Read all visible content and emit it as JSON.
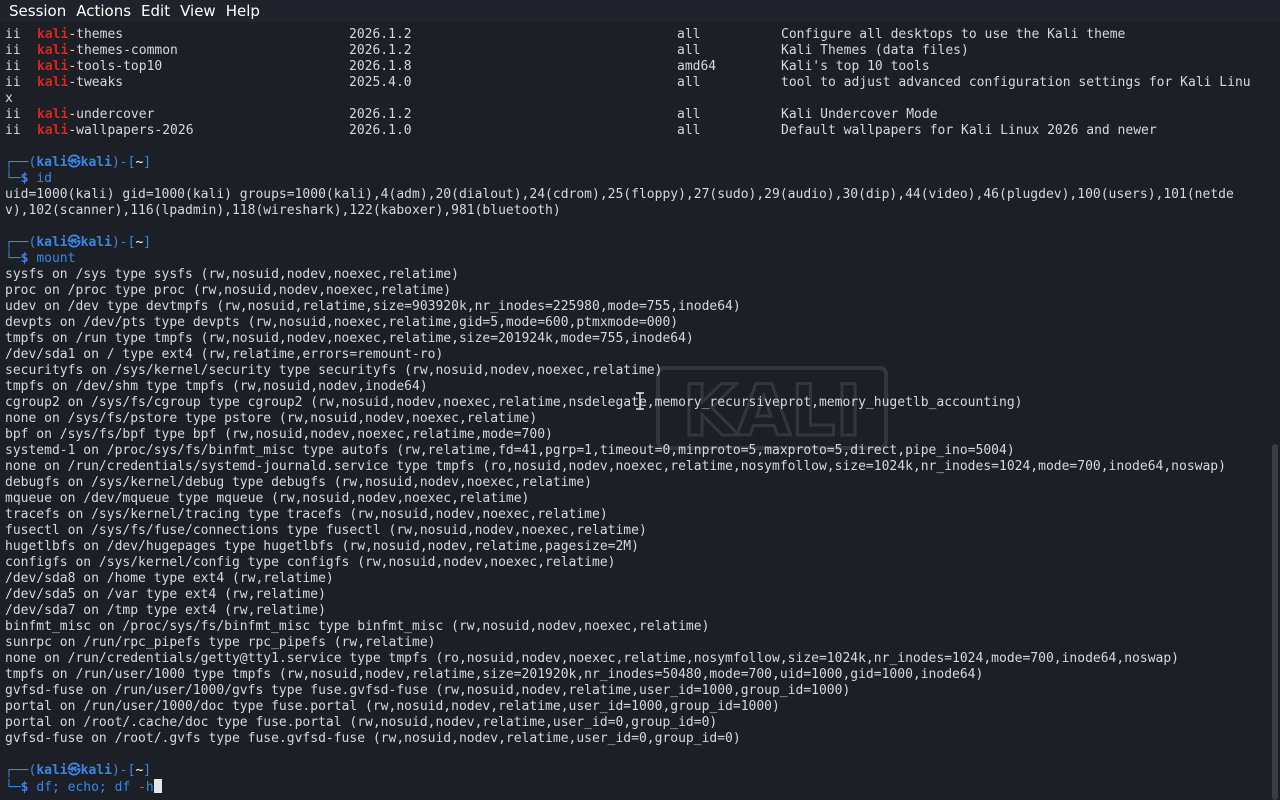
{
  "menubar": {
    "items": [
      "Session",
      "Actions",
      "Edit",
      "View",
      "Help"
    ]
  },
  "packages": [
    {
      "status": "ii",
      "prefix": "kali",
      "suffix": "-themes",
      "version": "2026.1.2",
      "arch": "all",
      "desc": "Configure all desktops to use the Kali theme"
    },
    {
      "status": "ii",
      "prefix": "kali",
      "suffix": "-themes-common",
      "version": "2026.1.2",
      "arch": "all",
      "desc": "Kali Themes (data files)"
    },
    {
      "status": "ii",
      "prefix": "kali",
      "suffix": "-tools-top10",
      "version": "2026.1.8",
      "arch": "amd64",
      "desc": "Kali's top 10 tools"
    },
    {
      "status": "ii",
      "prefix": "kali",
      "suffix": "-tweaks",
      "version": "2025.4.0",
      "arch": "all",
      "desc": "tool to adjust advanced configuration settings for Kali Linu",
      "wrap": "x"
    },
    {
      "status": "ii",
      "prefix": "kali",
      "suffix": "-undercover",
      "version": "2026.1.2",
      "arch": "all",
      "desc": "Kali Undercover Mode"
    },
    {
      "status": "ii",
      "prefix": "kali",
      "suffix": "-wallpapers-2026",
      "version": "2026.1.0",
      "arch": "all",
      "desc": "Default wallpapers for Kali Linux 2026 and newer"
    }
  ],
  "prompt": {
    "corner_top": "┌──(",
    "user": "kali",
    "at": "㉿",
    "host": "kali",
    "mid": ")-[",
    "dir": "~",
    "end": "]",
    "corner_bottom": "└─",
    "dollar": "$"
  },
  "commands": {
    "id": "id",
    "mount": "mount",
    "df": "df; echo; df -h"
  },
  "id_output": [
    "uid=1000(kali) gid=1000(kali) groups=1000(kali),4(adm),20(dialout),24(cdrom),25(floppy),27(sudo),29(audio),30(dip),44(video),46(plugdev),100(users),101(netde",
    "v),102(scanner),116(lpadmin),118(wireshark),122(kaboxer),981(bluetooth)"
  ],
  "mount_output": [
    "sysfs on /sys type sysfs (rw,nosuid,nodev,noexec,relatime)",
    "proc on /proc type proc (rw,nosuid,nodev,noexec,relatime)",
    "udev on /dev type devtmpfs (rw,nosuid,relatime,size=903920k,nr_inodes=225980,mode=755,inode64)",
    "devpts on /dev/pts type devpts (rw,nosuid,noexec,relatime,gid=5,mode=600,ptmxmode=000)",
    "tmpfs on /run type tmpfs (rw,nosuid,nodev,noexec,relatime,size=201924k,mode=755,inode64)",
    "/dev/sda1 on / type ext4 (rw,relatime,errors=remount-ro)",
    "securityfs on /sys/kernel/security type securityfs (rw,nosuid,nodev,noexec,relatime)",
    "tmpfs on /dev/shm type tmpfs (rw,nosuid,nodev,inode64)",
    "cgroup2 on /sys/fs/cgroup type cgroup2 (rw,nosuid,nodev,noexec,relatime,nsdelegate,memory_recursiveprot,memory_hugetlb_accounting)",
    "none on /sys/fs/pstore type pstore (rw,nosuid,nodev,noexec,relatime)",
    "bpf on /sys/fs/bpf type bpf (rw,nosuid,nodev,noexec,relatime,mode=700)",
    "systemd-1 on /proc/sys/fs/binfmt_misc type autofs (rw,relatime,fd=41,pgrp=1,timeout=0,minproto=5,maxproto=5,direct,pipe_ino=5004)",
    "none on /run/credentials/systemd-journald.service type tmpfs (ro,nosuid,nodev,noexec,relatime,nosymfollow,size=1024k,nr_inodes=1024,mode=700,inode64,noswap)",
    "debugfs on /sys/kernel/debug type debugfs (rw,nosuid,nodev,noexec,relatime)",
    "mqueue on /dev/mqueue type mqueue (rw,nosuid,nodev,noexec,relatime)",
    "tracefs on /sys/kernel/tracing type tracefs (rw,nosuid,nodev,noexec,relatime)",
    "fusectl on /sys/fs/fuse/connections type fusectl (rw,nosuid,nodev,noexec,relatime)",
    "hugetlbfs on /dev/hugepages type hugetlbfs (rw,nosuid,nodev,relatime,pagesize=2M)",
    "configfs on /sys/kernel/config type configfs (rw,nosuid,nodev,noexec,relatime)",
    "/dev/sda8 on /home type ext4 (rw,relatime)",
    "/dev/sda5 on /var type ext4 (rw,relatime)",
    "/dev/sda7 on /tmp type ext4 (rw,relatime)",
    "binfmt_misc on /proc/sys/fs/binfmt_misc type binfmt_misc (rw,nosuid,nodev,noexec,relatime)",
    "sunrpc on /run/rpc_pipefs type rpc_pipefs (rw,relatime)",
    "none on /run/credentials/getty@tty1.service type tmpfs (ro,nosuid,nodev,noexec,relatime,nosymfollow,size=1024k,nr_inodes=1024,mode=700,inode64,noswap)",
    "tmpfs on /run/user/1000 type tmpfs (rw,nosuid,nodev,relatime,size=201920k,nr_inodes=50480,mode=700,uid=1000,gid=1000,inode64)",
    "gvfsd-fuse on /run/user/1000/gvfs type fuse.gvfsd-fuse (rw,nosuid,nodev,relatime,user_id=1000,group_id=1000)",
    "portal on /run/user/1000/doc type fuse.portal (rw,nosuid,nodev,relatime,user_id=1000,group_id=1000)",
    "portal on /root/.cache/doc type fuse.portal (rw,nosuid,nodev,relatime,user_id=0,group_id=0)",
    "gvfsd-fuse on /root/.gvfs type fuse.gvfsd-fuse (rw,nosuid,nodev,relatime,user_id=0,group_id=0)"
  ],
  "watermark_text": "KALI",
  "colors": {
    "background": "#1c1f26",
    "text": "#d5d8de",
    "kali_red": "#e02020",
    "prompt_blue": "#3a86e8"
  }
}
